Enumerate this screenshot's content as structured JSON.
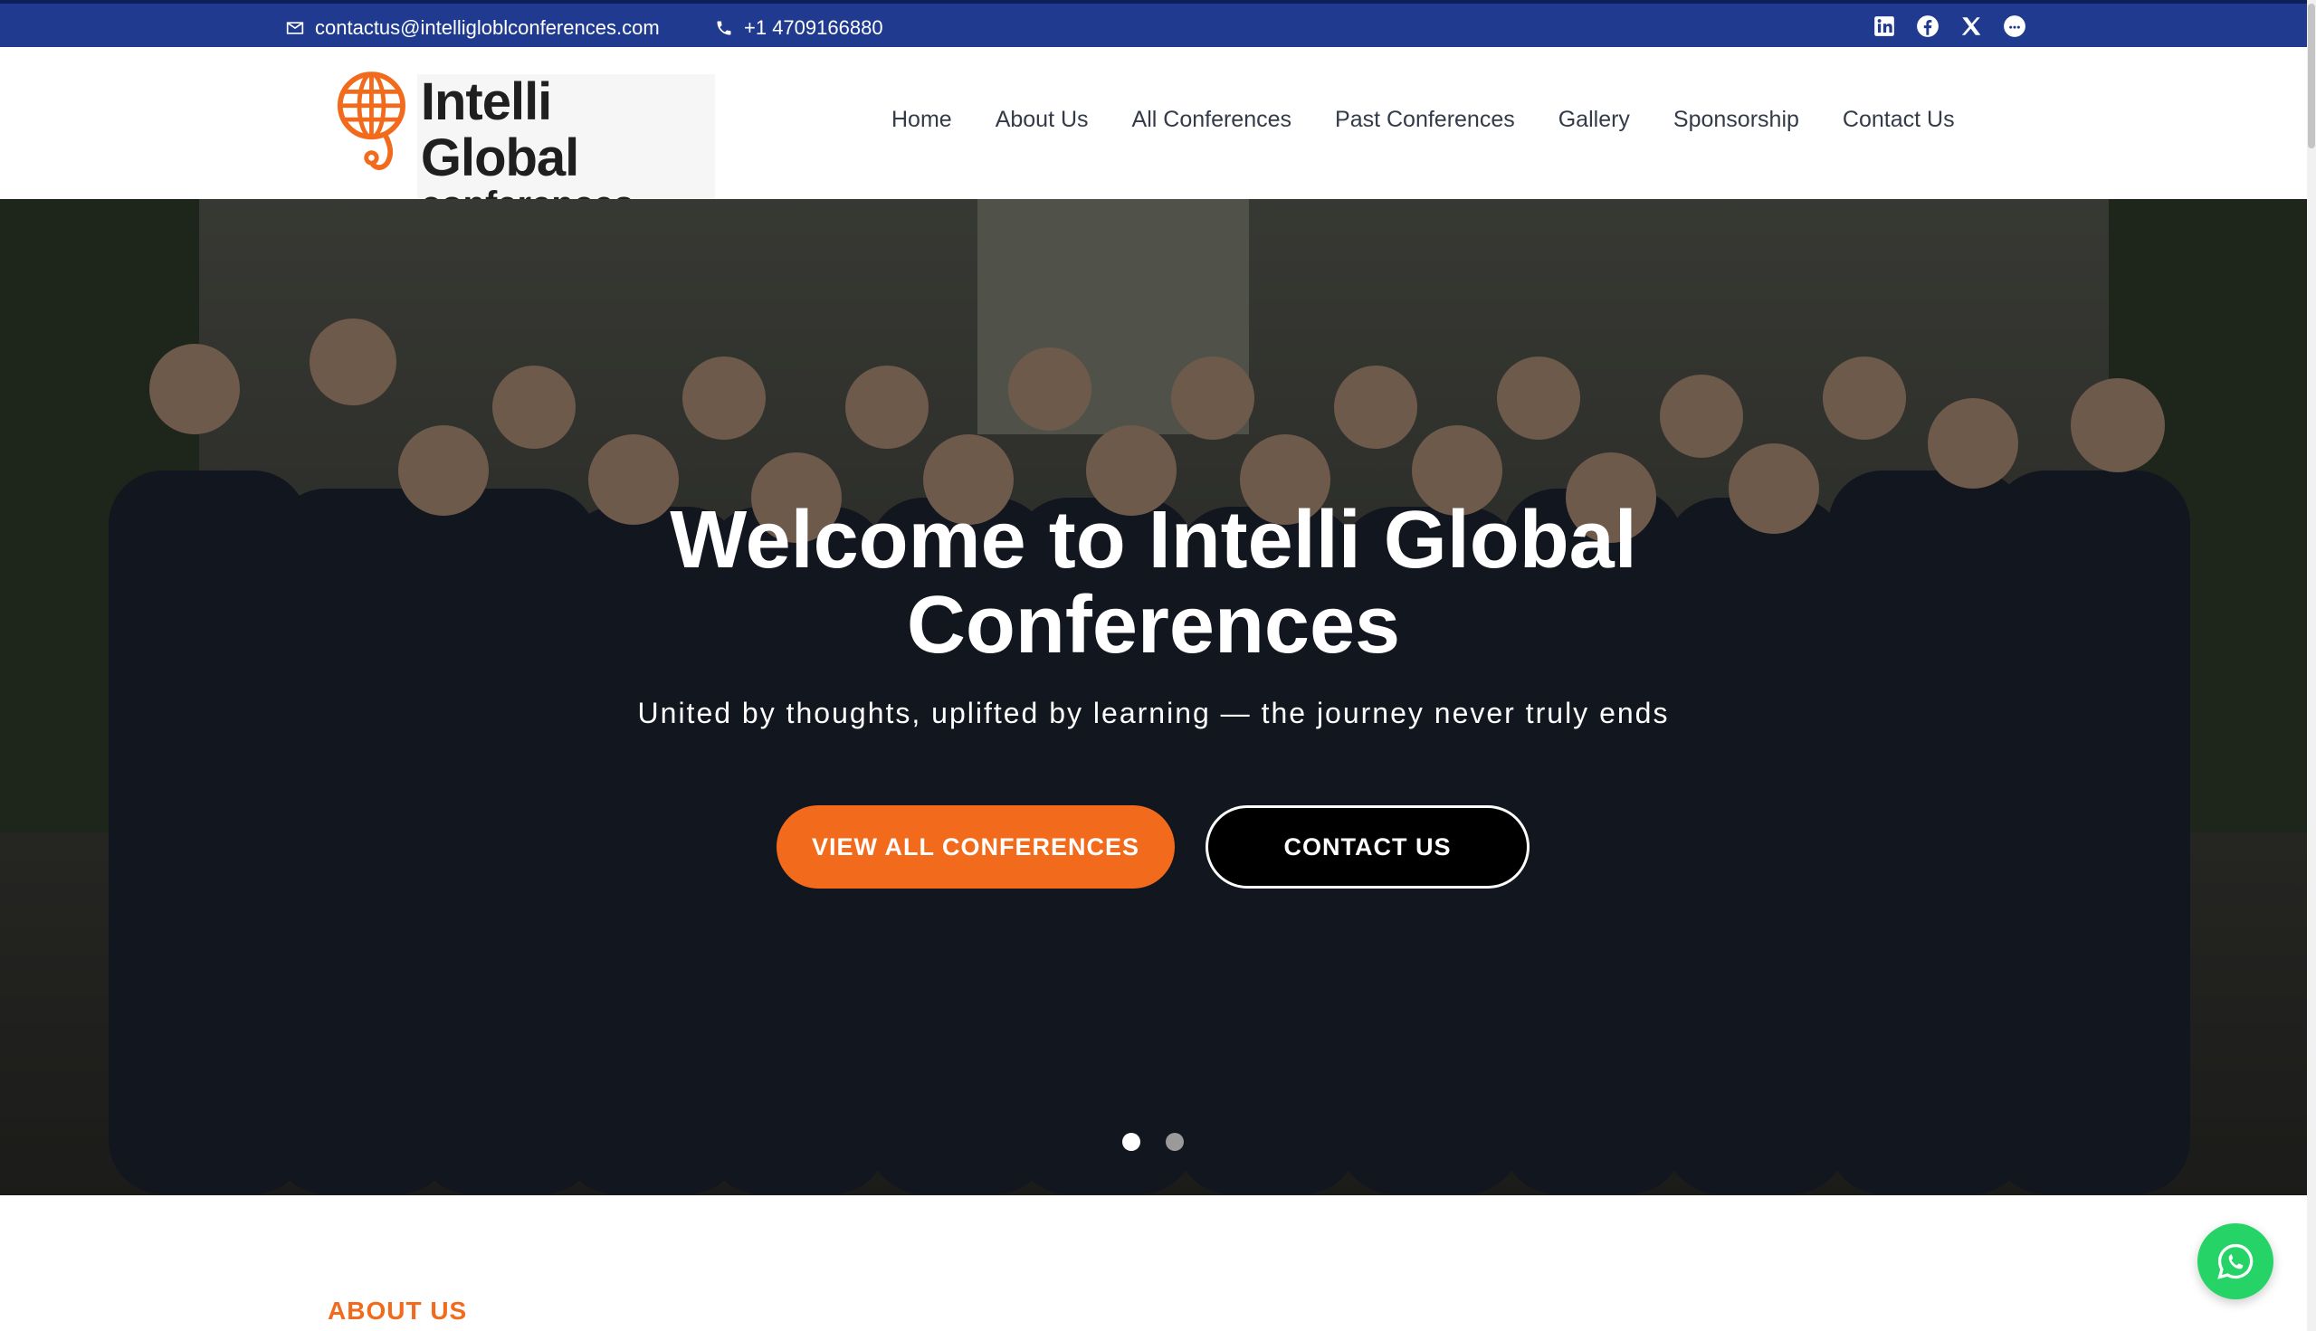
{
  "topbar": {
    "email": "contactus@intelligloblconferences.com",
    "phone": "+1 4709166880",
    "socials": [
      "linkedin-icon",
      "facebook-icon",
      "x-icon",
      "chat-icon"
    ]
  },
  "logo": {
    "title": "Intelli Global",
    "subtitle": "conferences"
  },
  "nav": {
    "items": [
      {
        "label": "Home"
      },
      {
        "label": "About Us"
      },
      {
        "label": "All Conferences"
      },
      {
        "label": "Past Conferences"
      },
      {
        "label": "Gallery"
      },
      {
        "label": "Sponsorship"
      },
      {
        "label": "Contact Us"
      }
    ]
  },
  "hero": {
    "title": "Welcome to Intelli Global Conferences",
    "subtitle": "United by thoughts, uplifted by learning — the journey never truly ends",
    "primary_button": "VIEW ALL CONFERENCES",
    "secondary_button": "CONTACT US",
    "slides": 2,
    "active_slide": 1
  },
  "about": {
    "label": "ABOUT US"
  },
  "colors": {
    "topbar": "#1f3a8f",
    "accent": "#f26b1d",
    "whatsapp": "#25d366"
  }
}
